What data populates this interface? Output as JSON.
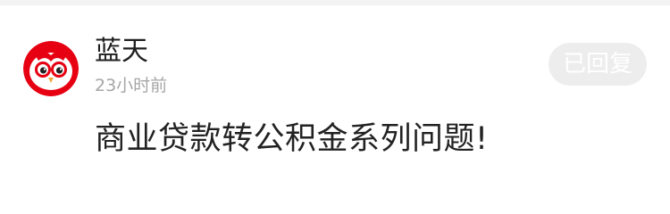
{
  "post": {
    "author": "蓝天",
    "time": "23小时前",
    "reply_button_label": "已回复",
    "content": "商业贷款转公积金系列问题!"
  },
  "colors": {
    "avatar_red": "#e60012",
    "avatar_white": "#ffffff",
    "reply_button_bg": "#ededed",
    "reply_button_text": "#ffffff",
    "time_text": "#a6a6a6"
  },
  "icons": {
    "avatar": "owl-face-avatar-icon"
  }
}
